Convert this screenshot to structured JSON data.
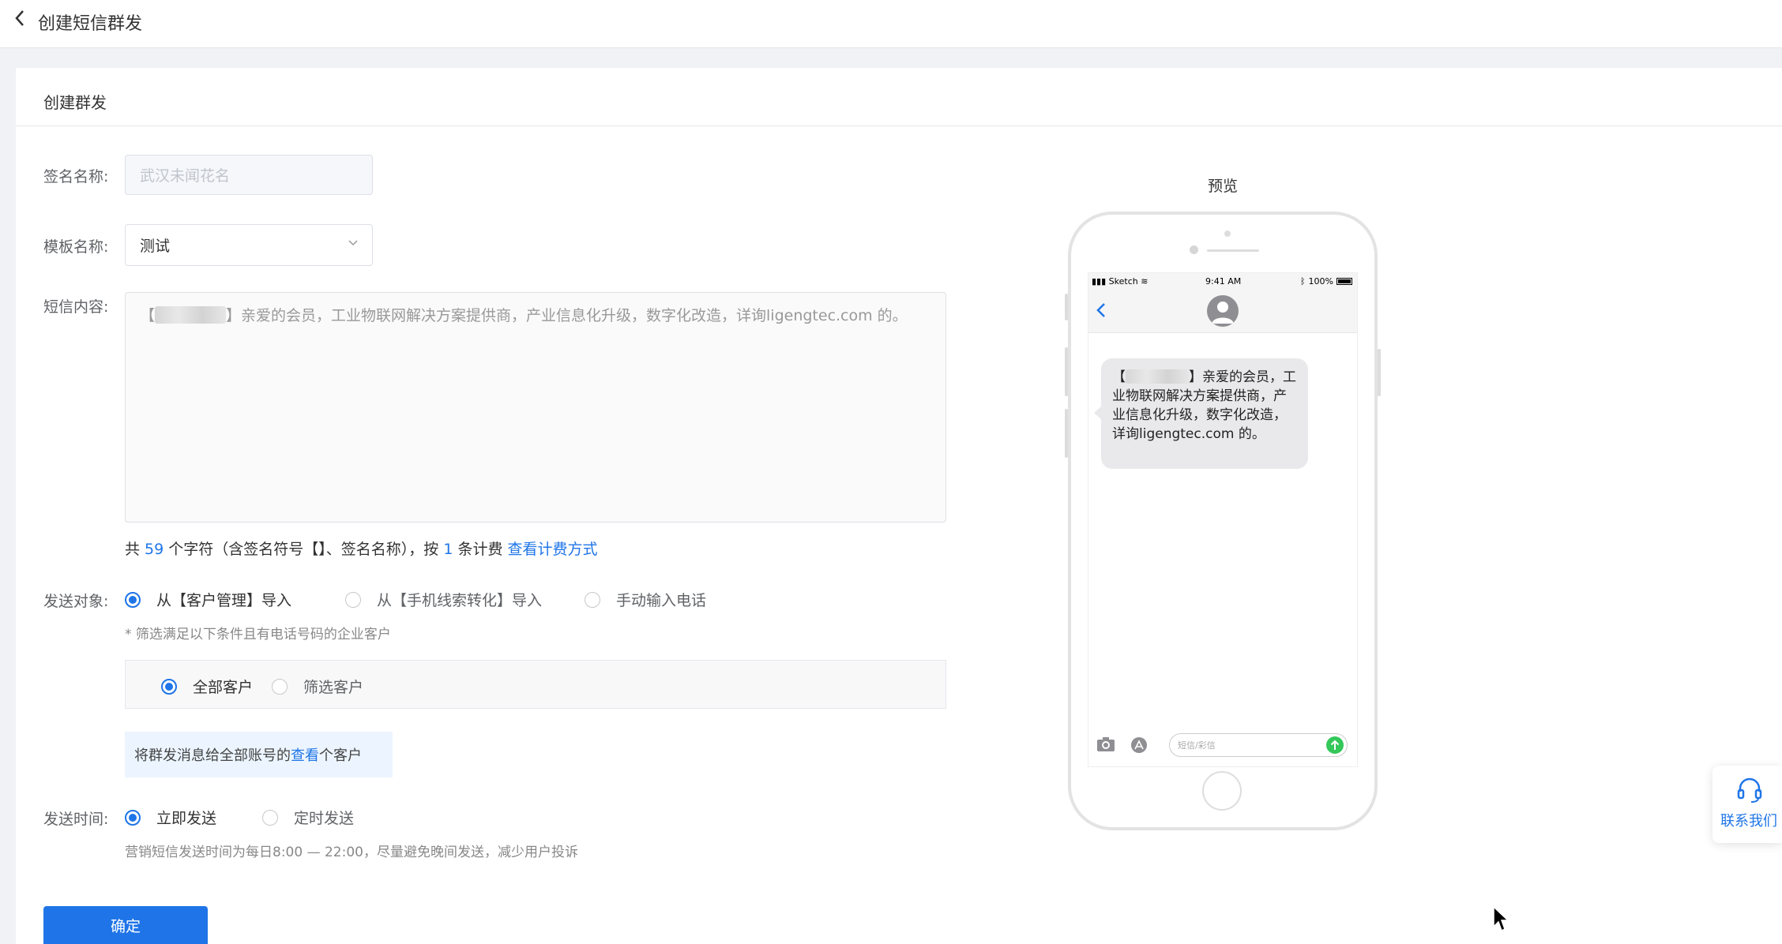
{
  "header": {
    "title": "创建短信群发"
  },
  "card": {
    "title": "创建群发"
  },
  "form": {
    "signature_label": "签名名称:",
    "signature_value": "武汉未闻花名",
    "template_label": "模板名称:",
    "template_value": "测试",
    "content_label": "短信内容:",
    "content_prefix": "【",
    "content_text": "】亲爱的会员，工业物联网解决方案提供商，产业信息化升级，数字化改造，详询ligengtec.com 的。",
    "count": {
      "p1": "共 ",
      "chars": "59",
      "p2": " 个字符（含签名符号【】、签名名称），按 ",
      "pieces": "1",
      "p3": " 条计费 ",
      "link": "查看计费方式"
    },
    "target_label": "发送对象:",
    "target_options": [
      "从【客户管理】导入",
      "从【手机线索转化】导入",
      "手动输入电话"
    ],
    "target_hint": "* 筛选满足以下条件且有电话号码的企业客户",
    "filter_options": [
      "全部客户",
      "筛选客户"
    ],
    "info": {
      "p1": "将群发消息给全部账号的 ",
      "link": "查看",
      "p2": " 个客户"
    },
    "time_label": "发送时间:",
    "time_options": [
      "立即发送",
      "定时发送"
    ],
    "time_hint": "营销短信发送时间为每日8:00 — 22:00，尽量避免晚间发送，减少用户投诉",
    "submit": "确定"
  },
  "preview": {
    "label": "预览",
    "status_carrier": "Sketch",
    "status_time": "9:41 AM",
    "status_battery": "100%",
    "bubble_prefix": "【",
    "bubble_text": "】亲爱的会员，工业物联网解决方案提供商，产业信息化升级，数字化改造，详询ligengtec.com 的。",
    "compose_placeholder": "短信/彩信"
  },
  "contact": {
    "label": "联系我们"
  },
  "colors": {
    "primary": "#1f75e8",
    "info_bg": "#ecf5ff",
    "send_green": "#34c759"
  }
}
